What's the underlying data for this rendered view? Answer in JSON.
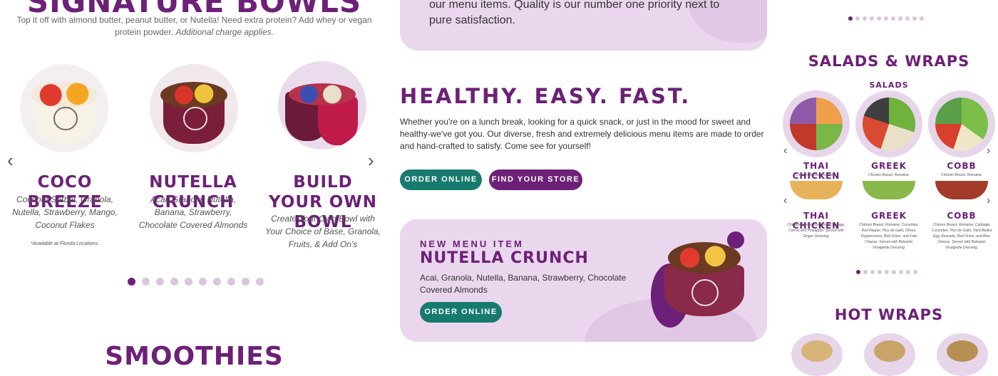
{
  "signature": {
    "title": "SIGNATURE BOWLS",
    "subtitle": "Top it off with almond butter, peanut butter, or Nutella! Need extra protein? Add whey or vegan protein powder.",
    "subtitle_italic": "Additional charge applies.",
    "products": [
      {
        "name": "COCO BREEZE",
        "desc": "Coconut Sorbet, Granola, Nutella, Strawberry, Mango, Coconut Flakes",
        "note": "*Available at Florida Locations."
      },
      {
        "name": "NUTELLA CRUNCH",
        "desc": "Acai, Granola, Nutella, Banana, Strawberry, Chocolate Covered Almonds",
        "note": ""
      },
      {
        "name": "BUILD YOUR OWN BOWL",
        "desc": "Create Your Own Bowl with Your Choice of Base, Granola, Fruits, & Add On's",
        "note": ""
      }
    ],
    "dots_count": 10,
    "active_dot": 0
  },
  "smoothies": {
    "title": "SMOOTHIES"
  },
  "quality": {
    "text": "our menu items. Quality is our number one priority next to pure satisfaction."
  },
  "hef": {
    "title": "HEALTHY. EASY. FAST.",
    "body": "Whether you're on a lunch break, looking for a quick snack, or just in the mood for sweet and healthy-we've got you. Our diverse, fresh and extremely delicious menu items are made to order and hand-crafted to satisfy. Come see for yourself!",
    "order_label": "ORDER ONLINE",
    "store_label": "FIND YOUR STORE"
  },
  "new_item": {
    "kicker": "NEW MENU ITEM",
    "title": "NUTELLA CRUNCH",
    "desc": "Acai, Granola, Nutella, Banana, Strawberry, Chocolate Covered Almonds",
    "order_label": "ORDER ONLINE"
  },
  "salads_wraps": {
    "title": "SALADS & WRAPS",
    "subtitle": "SALADS",
    "row1": [
      {
        "name": "THAI CHICKEN",
        "desc": "Chicken Breast. Romaine."
      },
      {
        "name": "GREEK",
        "desc": "Chicken Breast. Romaine."
      },
      {
        "name": "COBB",
        "desc": "Chicken Breast. Romaine."
      }
    ],
    "row2": [
      {
        "name": "THAI CHICKEN",
        "desc": "Chicken Breast, Romaine, Cabbage, Carrot, and Pineapple. Served with Ginger Dressing."
      },
      {
        "name": "GREEK",
        "desc": "Chicken Breast, Romaine, Cucumber, Red Pepper, Pico de Gallo, Olives, Pepperoncini, Red Onion, and Feta Cheese. Served with Balsamic Vinaigrette Dressing."
      },
      {
        "name": "COBB",
        "desc": "Chicken Breast, Romaine, Cabbage, Cucumber, Pico de Gallo, Hard-Boiled Egg, Avocado, Red Onion, and Blue Cheese. Served with Balsamic Vinaigrette Dressing."
      }
    ],
    "hot_wraps_title": "HOT WRAPS"
  },
  "icons": {
    "prev": "chevron-left-icon",
    "next": "chevron-right-icon"
  },
  "colors": {
    "brand_purple": "#6d2077",
    "teal": "#167b6e",
    "card_bg": "#ead7ed"
  }
}
